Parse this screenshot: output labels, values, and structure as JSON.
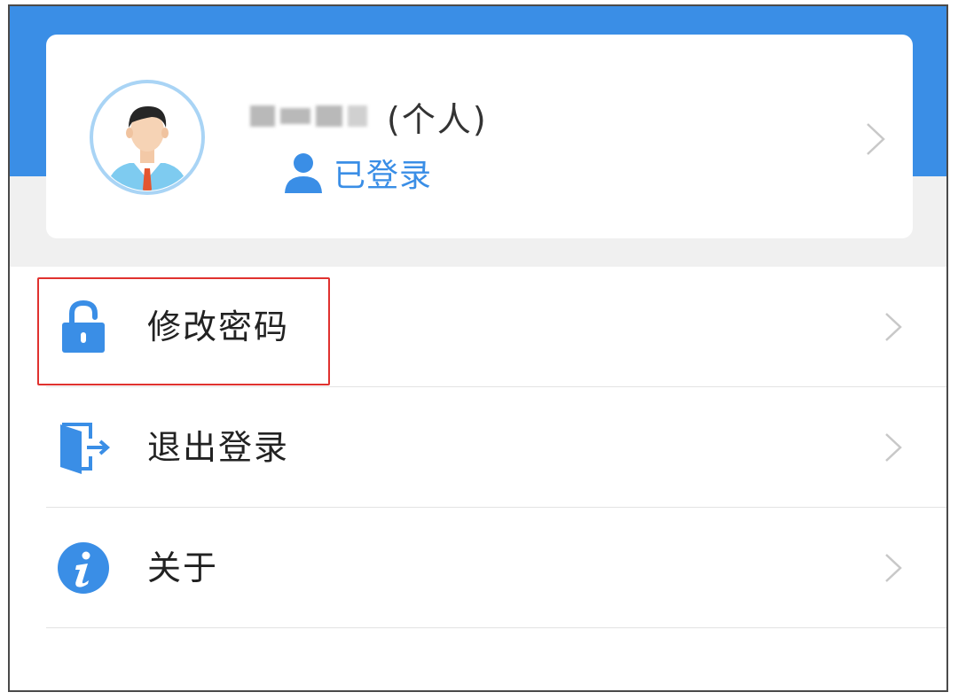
{
  "profile": {
    "name_suffix": "(个人)",
    "status_label": "已登录",
    "avatar_icon": "user-avatar-icon",
    "status_icon": "user-icon"
  },
  "menu": {
    "items": [
      {
        "label": "修改密码",
        "icon": "lock-icon",
        "highlighted": true
      },
      {
        "label": "退出登录",
        "icon": "logout-door-icon",
        "highlighted": false
      },
      {
        "label": "关于",
        "icon": "info-icon",
        "highlighted": false
      }
    ]
  },
  "colors": {
    "primary": "#3a8ee6",
    "header_bg": "#3a8ee6",
    "band_bg": "#f0f0f0",
    "highlight": "#e0322f",
    "text": "#222222",
    "chevron": "#c8c8c8"
  }
}
